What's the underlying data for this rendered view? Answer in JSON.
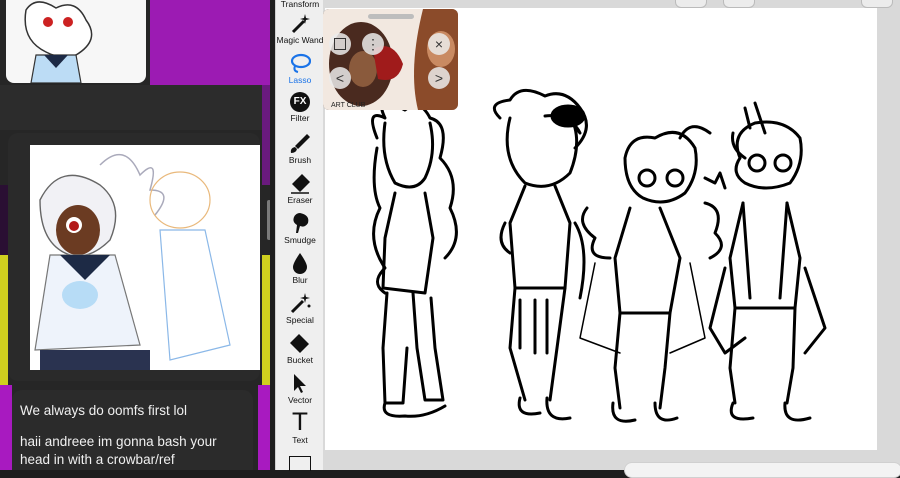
{
  "toolbar": {
    "tools": [
      {
        "label": "Transform",
        "icon": "transform-icon"
      },
      {
        "label": "Magic Wand",
        "icon": "magic-wand-icon"
      },
      {
        "label": "Lasso",
        "icon": "lasso-icon",
        "active": true
      },
      {
        "label": "Filter",
        "icon": "fx-icon",
        "glyph": "FX"
      },
      {
        "label": "Brush",
        "icon": "brush-icon"
      },
      {
        "label": "Eraser",
        "icon": "eraser-icon"
      },
      {
        "label": "Smudge",
        "icon": "smudge-icon"
      },
      {
        "label": "Blur",
        "icon": "blur-drop-icon"
      },
      {
        "label": "Special",
        "icon": "special-icon"
      },
      {
        "label": "Bucket",
        "icon": "bucket-icon"
      },
      {
        "label": "Vector",
        "icon": "vector-arrow-icon"
      },
      {
        "label": "Text",
        "icon": "text-icon",
        "glyph": "T"
      }
    ],
    "accent": "#1a73e8"
  },
  "chat": {
    "messages": [
      "We always do oomfs first lol",
      "haii andreee im gonna bash your",
      "head in with a crowbar/ref"
    ],
    "band_colors": [
      "#5a1470",
      "#a21ab8",
      "#c72bd8",
      "#6a1f7d",
      "#d4d418",
      "#e0e02a",
      "#a81ac0"
    ]
  },
  "reference": {
    "nav_prev": "<",
    "nav_next": ">",
    "close": "×",
    "more": "⋮"
  }
}
